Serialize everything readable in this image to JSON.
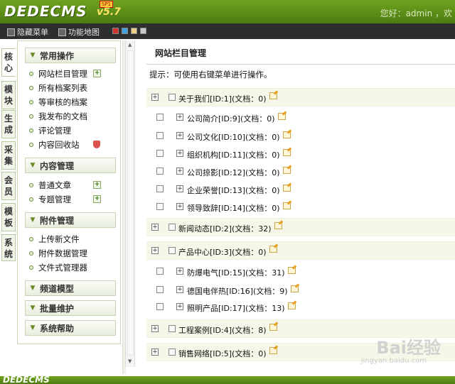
{
  "header": {
    "logo": "DEDECMS",
    "version": "v5.7",
    "badge": "SP1",
    "greeting": "您好：admin ，欢"
  },
  "toolbar": {
    "hide_menu": "隐藏菜单",
    "site_map": "功能地图",
    "swatches": [
      "#d0342c",
      "#3fa0e0",
      "#e8d08a",
      "#c8c8c8"
    ]
  },
  "vtabs": [
    "核心",
    "模块",
    "生成",
    "采集",
    "会员",
    "模板",
    "系统"
  ],
  "sidebar": {
    "groups": {
      "common": "常用操作",
      "content": "内容管理",
      "attach": "附件管理",
      "channel": "频道模型",
      "batch": "批量维护",
      "help": "系统帮助"
    },
    "common_items": [
      "网站栏目管理",
      "所有档案列表",
      "等审核的档案",
      "我发布的文档",
      "评论管理",
      "内容回收站"
    ],
    "content_items": [
      "普通文章",
      "专题管理"
    ],
    "attach_items": [
      "上传新文件",
      "附件数据管理",
      "文件式管理器"
    ]
  },
  "main": {
    "title": "网站栏目管理",
    "hint": "提示：可使用右键菜单进行操作。"
  },
  "tree": [
    {
      "label": "关于我们[ID:1](文档：0)",
      "level": 0
    },
    {
      "label": "公司简介[ID:9](文档：0)",
      "level": 1
    },
    {
      "label": "公司文化[ID:10](文档：0)",
      "level": 1
    },
    {
      "label": "组织机构[ID:11](文档：0)",
      "level": 1
    },
    {
      "label": "公司掠影[ID:12](文档：0)",
      "level": 1
    },
    {
      "label": "企业荣誉[ID:13](文档：0)",
      "level": 1
    },
    {
      "label": "领导致辞[ID:14](文档：0)",
      "level": 1
    },
    {
      "label": "新闻动态[ID:2](文档：32)",
      "level": 0
    },
    {
      "label": "产品中心[ID:3](文档：0)",
      "level": 0
    },
    {
      "label": "防爆电气[ID:15](文档：31)",
      "level": 1
    },
    {
      "label": "德国电伴热[ID:16](文档：9)",
      "level": 1
    },
    {
      "label": "照明产品[ID:17](文档：13)",
      "level": 1
    },
    {
      "label": "工程案例[ID:4](文档：8)",
      "level": 0
    },
    {
      "label": "销售网络[ID:5](文档：0)",
      "level": 0
    }
  ],
  "watermark": "Bai经验",
  "watermark_sub": "jingyan.baidu.com"
}
